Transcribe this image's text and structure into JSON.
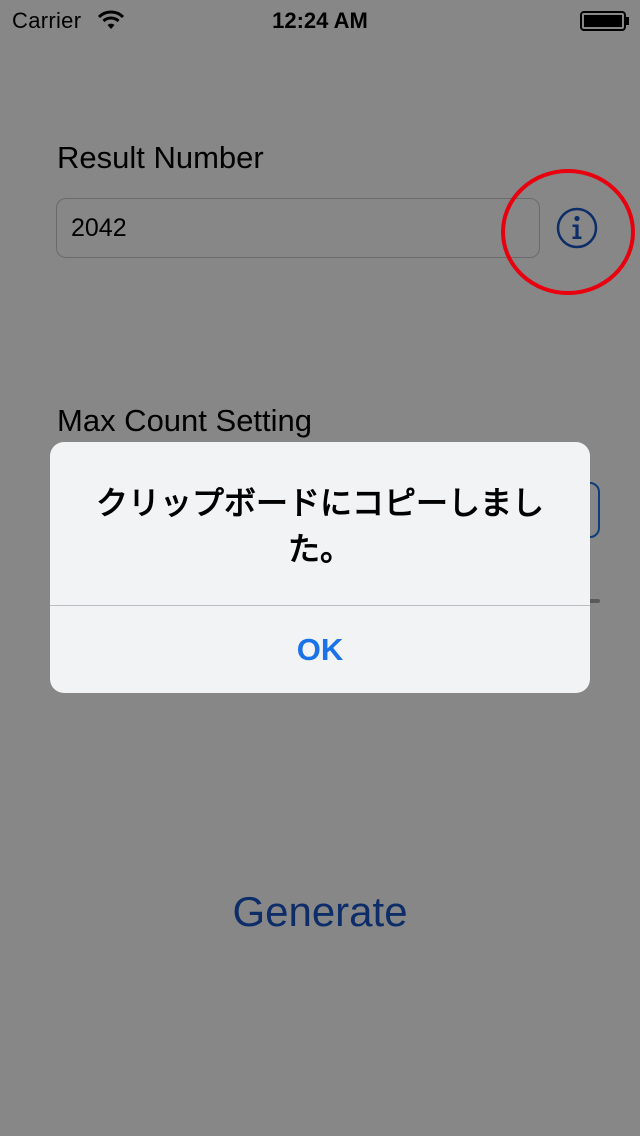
{
  "status_bar": {
    "carrier": "Carrier",
    "time": "12:24 AM",
    "wifi_icon": "wifi-icon",
    "battery_icon": "battery-icon"
  },
  "result": {
    "label": "Result Number",
    "value": "2042",
    "info_icon": "info-icon"
  },
  "max_count": {
    "label": "Max Count Setting"
  },
  "generate_button": {
    "label": "Generate"
  },
  "alert": {
    "message": "クリップボードにコピーしました。",
    "ok_label": "OK"
  },
  "colors": {
    "tint": "#1a55c4",
    "alert_button": "#1a73e8",
    "annotation_circle": "#e8000e",
    "dim_overlay": "rgba(0,0,0,0.47)"
  }
}
